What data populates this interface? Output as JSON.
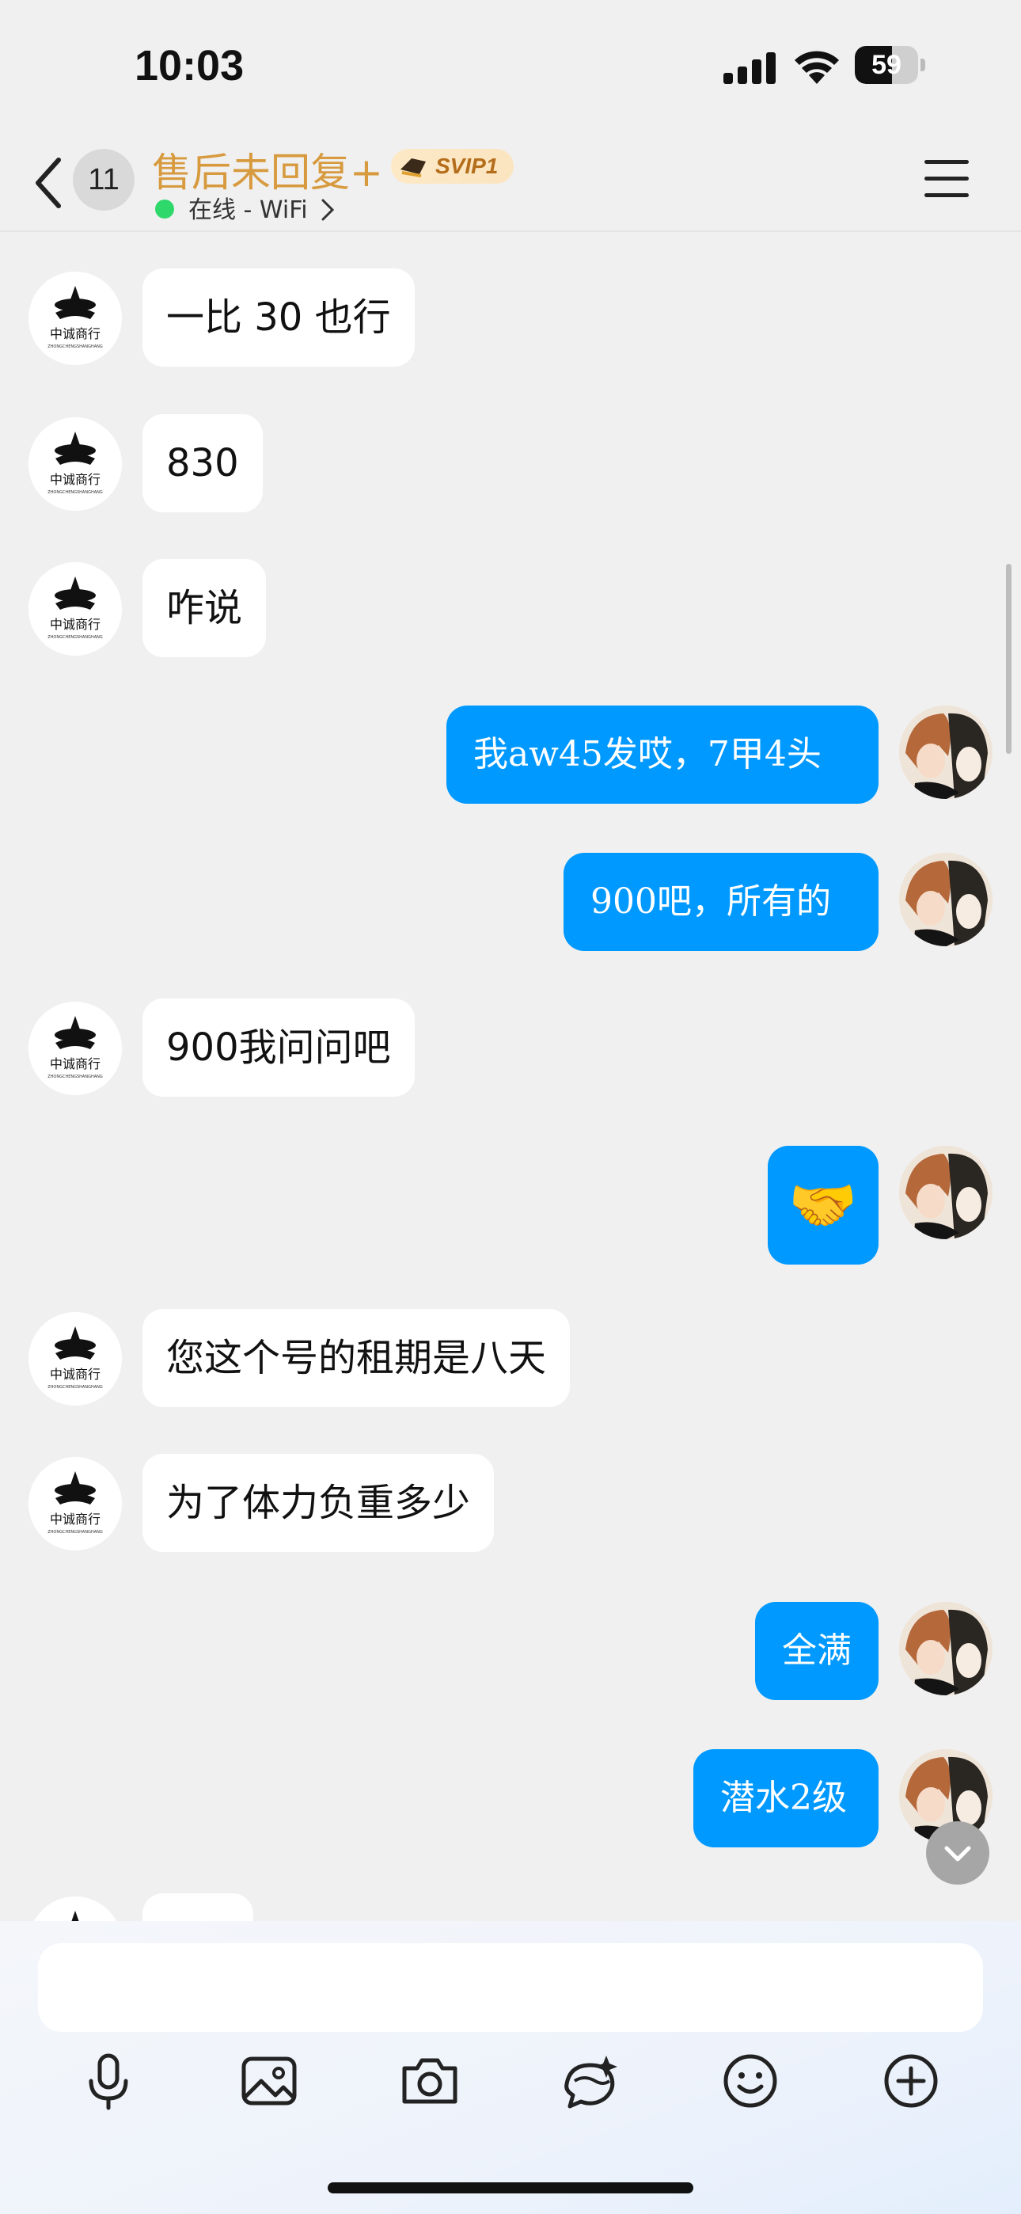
{
  "status_bar": {
    "time": "10:03",
    "battery": "59"
  },
  "header": {
    "unread_count": "11",
    "title": "售后未回复+",
    "svip_label": "SVIP1",
    "status": "在线 - WiFi"
  },
  "messages": [
    {
      "side": "left",
      "text": "一比 30 也行"
    },
    {
      "side": "left",
      "text": "830"
    },
    {
      "side": "left",
      "text": "咋说"
    },
    {
      "side": "right",
      "text": "我aw45发哎，7甲4头"
    },
    {
      "side": "right",
      "text": "900吧，所有的"
    },
    {
      "side": "left",
      "text": "900我问问吧"
    },
    {
      "side": "right",
      "text": "🤝"
    },
    {
      "side": "left",
      "text": "您这个号的租期是八天"
    },
    {
      "side": "left",
      "text": "为了体力负重多少"
    },
    {
      "side": "right",
      "text": "全满"
    },
    {
      "side": "right",
      "text": "潜水2级"
    }
  ],
  "colors": {
    "title": "#d79a3e",
    "outgoing_bubble": "#0099ff",
    "incoming_bubble": "#ffffff",
    "background": "#f0f0f0",
    "online": "#2fd86a"
  },
  "icons": [
    "back-icon",
    "menu-icon",
    "microphone-icon",
    "image-icon",
    "camera-icon",
    "sticker-icon",
    "emoji-icon",
    "plus-icon",
    "chevron-down-icon"
  ]
}
